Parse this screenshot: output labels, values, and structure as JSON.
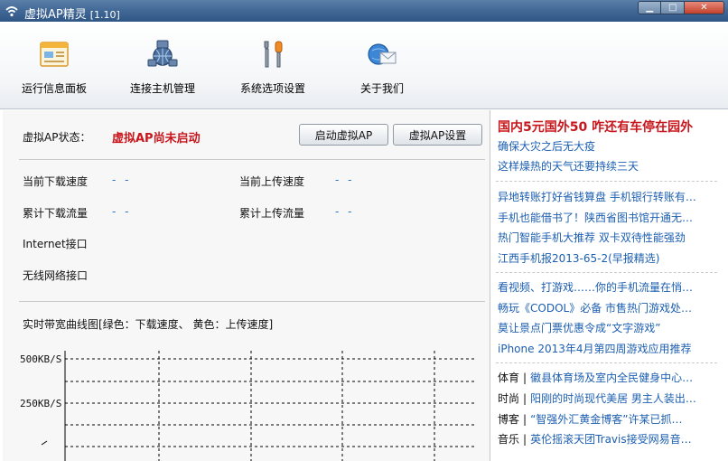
{
  "window": {
    "title": "虚拟AP精灵",
    "version": "[1.10]",
    "min": "▁",
    "max": "□",
    "close": "✕"
  },
  "toolbar": [
    {
      "label": "运行信息面板"
    },
    {
      "label": "连接主机管理"
    },
    {
      "label": "系统选项设置"
    },
    {
      "label": "关于我们"
    }
  ],
  "status": {
    "label": "虚拟AP状态：",
    "value": "虚拟AP尚未启动"
  },
  "buttons": {
    "start": "启动虚拟AP",
    "settings": "虚拟AP设置"
  },
  "stats": {
    "down_speed_label": "当前下载速度",
    "down_speed_value": "- -",
    "up_speed_label": "当前上传速度",
    "up_speed_value": "- -",
    "down_total_label": "累计下载流量",
    "down_total_value": "- -",
    "up_total_label": "累计上传流量",
    "up_total_value": "- -",
    "internet_label": "Internet接口",
    "wireless_label": "无线网络接口"
  },
  "chart": {
    "caption": "实时带宽曲线图[绿色：下载速度、 黄色：上传速度]",
    "ytick_top": "500KB/S",
    "ytick_mid": "250KB/S",
    "colors": {
      "download": "#2aa02a",
      "upload": "#e8c400"
    }
  },
  "news": {
    "headline": "国内5元国外50  咋还有车停在园外",
    "group1": [
      "确保大灾之后无大疫",
      "这样燥热的天气还要持续三天"
    ],
    "group2": [
      "异地转账打好省钱算盘  手机银行转账有…",
      "手机也能借书了！陕西省图书馆开通无…",
      "热门智能手机大推荐  双卡双待性能强劲",
      "江西手机报2013-65-2(早报精选)"
    ],
    "group3": [
      "看视频、打游戏……你的手机流量在悄…",
      "畅玩《CODOL》必备  市售热门游戏处…",
      "莫让景点门票优惠令成“文字游戏”",
      "iPhone 2013年4月第四周游戏应用推荐"
    ],
    "group4": [
      {
        "cat": "体育",
        "text": "徽县体育场及室内全民健身中心…"
      },
      {
        "cat": "时尚",
        "text": "阳刚的时尚现代美居  男主人装出…"
      },
      {
        "cat": "博客",
        "text": "“智强外汇黄金博客”许某已抓…"
      },
      {
        "cat": "音乐",
        "text": "英伦摇滚天团Travis接受网易音…"
      }
    ]
  }
}
